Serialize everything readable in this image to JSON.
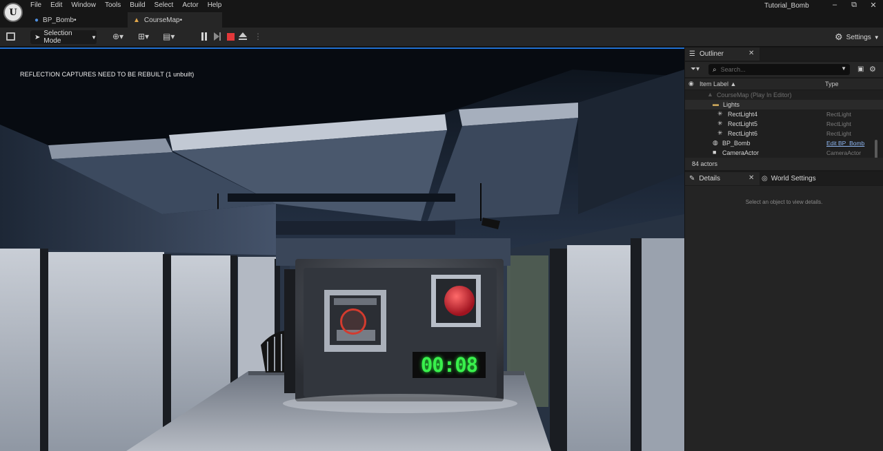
{
  "app": {
    "project_name": "Tutorial_Bomb",
    "logo_letter": "U"
  },
  "menu": [
    "File",
    "Edit",
    "Window",
    "Tools",
    "Build",
    "Select",
    "Actor",
    "Help"
  ],
  "window_controls": {
    "minimize": "–",
    "restore": "⧉",
    "close": "✕"
  },
  "tabs": [
    {
      "label": "BP_Bomb•",
      "icon": "blueprint-icon",
      "active": false
    },
    {
      "label": "CourseMap•",
      "icon": "level-icon",
      "active": true
    }
  ],
  "toolbar": {
    "selection_mode": "Selection Mode",
    "settings": "Settings",
    "stop_color": "#e3383a"
  },
  "viewport": {
    "warning": "REFLECTION CAPTURES NEED TO BE REBUILT (1 unbuilt)",
    "timer_text": "00:08",
    "timer_color": "#39f04c"
  },
  "outliner": {
    "title": "Outliner",
    "search_placeholder": "Search...",
    "columns": {
      "label": "Item Label ▲",
      "type": "Type"
    },
    "rows": [
      {
        "name": "CourseMap (Play In Editor)",
        "type": "",
        "indent": 0,
        "icon": "level-icon"
      },
      {
        "name": "Lights",
        "type": "",
        "indent": 1,
        "icon": "folder-icon"
      },
      {
        "name": "RectLight4",
        "type": "RectLight",
        "indent": 2,
        "icon": "light-icon"
      },
      {
        "name": "RectLight5",
        "type": "RectLight",
        "indent": 2,
        "icon": "light-icon"
      },
      {
        "name": "RectLight6",
        "type": "RectLight",
        "indent": 2,
        "icon": "light-icon"
      },
      {
        "name": "BP_Bomb",
        "type": "Edit BP_Bomb",
        "indent": 1,
        "icon": "actor-icon"
      },
      {
        "name": "CameraActor",
        "type": "CameraActor",
        "indent": 1,
        "icon": "camera-icon"
      }
    ],
    "actor_count": "84 actors"
  },
  "details": {
    "title": "Details",
    "world_settings": "World Settings",
    "empty_message": "Select an object to view details."
  }
}
